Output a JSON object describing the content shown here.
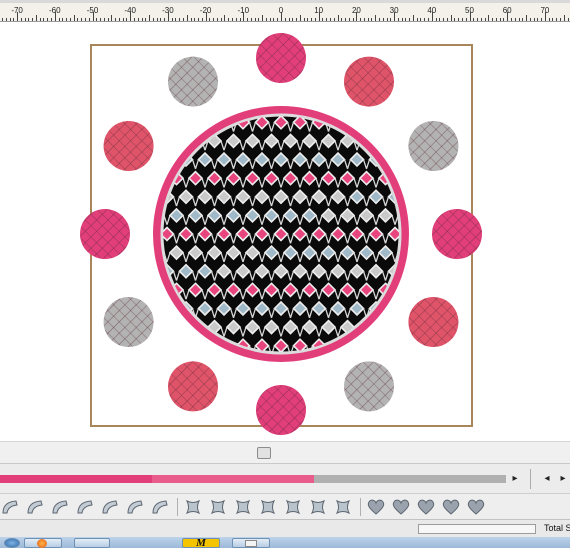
{
  "ruler": {
    "labels": [
      "-70",
      "-60",
      "-50",
      "-40",
      "-30",
      "-20",
      "-10",
      "0",
      "10",
      "20",
      "30",
      "40",
      "50",
      "60",
      "70"
    ]
  },
  "design": {
    "center_fill": "black",
    "quatrefoil_colors": [
      "#e8457f",
      "#c9c9c9",
      "#9fb9c8"
    ],
    "ring_color": "#e13e7a",
    "outer_circles": [
      "#e13e7a",
      "#e0546a",
      "#b3b3b3",
      "#e13e7a",
      "#e0546a",
      "#b3b3b3",
      "#e13e7a",
      "#e0546a",
      "#b3b3b3",
      "#e13e7a",
      "#e0546a",
      "#b3b3b3"
    ],
    "hoop_color": "#a9855a"
  },
  "timeline": {
    "segments": [
      {
        "color": "#e13e7a",
        "fraction": 0.3
      },
      {
        "color": "#e85b8b",
        "fraction": 0.32
      },
      {
        "color": "#b0b0b0",
        "fraction": 0.38
      }
    ],
    "play_icon": "▸",
    "prev_icon": "◂",
    "next_icon": "▸"
  },
  "toolbar": {
    "groups": [
      [
        "curve-tool-icon",
        "arc-tool-icon",
        "wave-tool-icon",
        "shape-tool-icon",
        "corner-tool-icon",
        "fan-tool-icon",
        "flag-tool-icon"
      ],
      [
        "square-frame-icon",
        "bracket-frame-icon",
        "scallop-frame-icon",
        "cross-frame-icon",
        "bow-frame-icon",
        "notch-frame-icon",
        "oval-frame-icon"
      ],
      [
        "heart-icon",
        "heart-ornate-icon",
        "heart-lace-icon",
        "heart-scroll-icon",
        "heart-plain-icon"
      ]
    ]
  },
  "status": {
    "progress": 0.0,
    "label": "Total S"
  },
  "taskbar": {
    "items": [
      "start-orb-icon",
      "firefox-icon",
      "quick-launch-icon",
      "app-m-icon",
      "documents-icon"
    ],
    "app_letter": "M"
  }
}
